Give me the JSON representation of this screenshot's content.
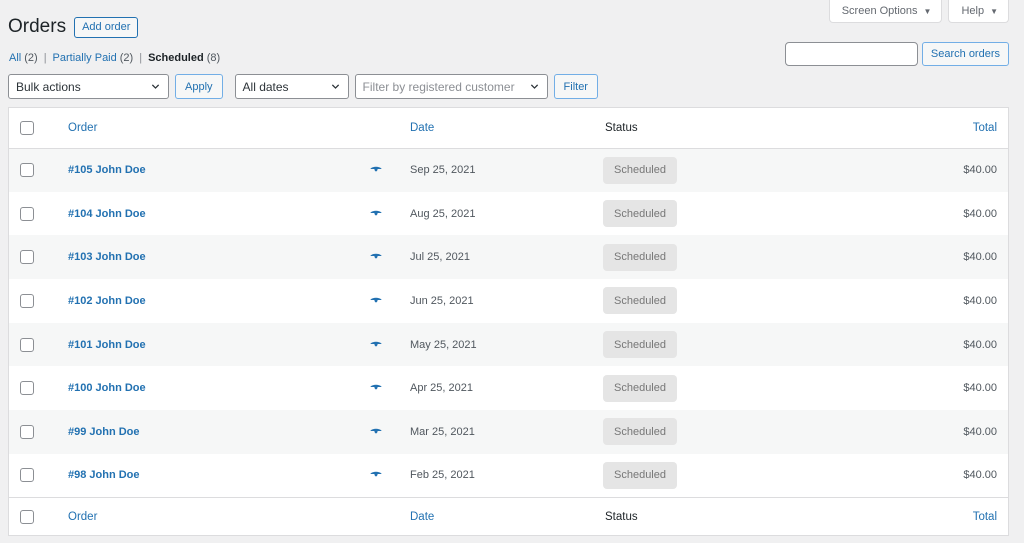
{
  "screen_meta": {
    "screen_options_label": "Screen Options",
    "help_label": "Help",
    "caret": "▼"
  },
  "header": {
    "title": "Orders",
    "add_order_label": "Add order"
  },
  "views": [
    {
      "label": "All",
      "count": "(2)",
      "current": false
    },
    {
      "label": "Partially Paid",
      "count": "(2)",
      "current": false
    },
    {
      "label": "Scheduled",
      "count": "(8)",
      "current": true
    }
  ],
  "views_separator": "|",
  "search": {
    "value": "",
    "button_label": "Search orders"
  },
  "tablenav": {
    "bulk_actions": "Bulk actions",
    "apply_label": "Apply",
    "dates": "All dates",
    "customer_placeholder": "Filter by registered customer",
    "filter_label": "Filter"
  },
  "table": {
    "columns": {
      "order": "Order",
      "date": "Date",
      "status": "Status",
      "total": "Total"
    },
    "rows": [
      {
        "order": "#105 John Doe",
        "date": "Sep 25, 2021",
        "status": "Scheduled",
        "total": "$40.00"
      },
      {
        "order": "#104 John Doe",
        "date": "Aug 25, 2021",
        "status": "Scheduled",
        "total": "$40.00"
      },
      {
        "order": "#103 John Doe",
        "date": "Jul 25, 2021",
        "status": "Scheduled",
        "total": "$40.00"
      },
      {
        "order": "#102 John Doe",
        "date": "Jun 25, 2021",
        "status": "Scheduled",
        "total": "$40.00"
      },
      {
        "order": "#101 John Doe",
        "date": "May 25, 2021",
        "status": "Scheduled",
        "total": "$40.00"
      },
      {
        "order": "#100 John Doe",
        "date": "Apr 25, 2021",
        "status": "Scheduled",
        "total": "$40.00"
      },
      {
        "order": "#99 John Doe",
        "date": "Mar 25, 2021",
        "status": "Scheduled",
        "total": "$40.00"
      },
      {
        "order": "#98 John Doe",
        "date": "Feb 25, 2021",
        "status": "Scheduled",
        "total": "$40.00"
      }
    ]
  },
  "colors": {
    "link": "#2271b1",
    "background": "#f0f0f1",
    "status_badge_bg": "#e5e5e5"
  },
  "icons": {
    "row_preview": "eye-icon",
    "select_arrow": "chevron-down-icon"
  }
}
